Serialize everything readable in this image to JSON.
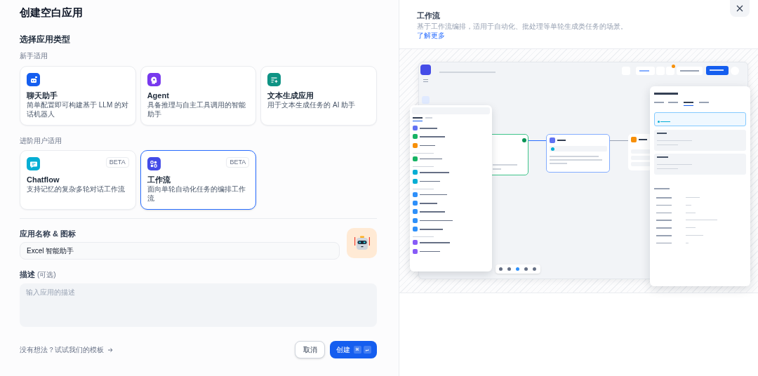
{
  "dialog": {
    "title": "创建空白应用"
  },
  "type_section": {
    "title": "选择应用类型",
    "groups": [
      {
        "label": "新手适用",
        "cards": [
          {
            "kind": "chat",
            "title": "聊天助手",
            "description": "简单配置即可构建基于 LLM 的对话机器人",
            "color": "#155eef",
            "selected": false
          },
          {
            "kind": "agent",
            "title": "Agent",
            "description": "具备推理与自主工具调用的智能助手",
            "color": "#7839ee",
            "selected": false
          },
          {
            "kind": "text",
            "title": "文本生成应用",
            "description": "用于文本生成任务的 AI 助手",
            "color": "#0e9384",
            "selected": false
          }
        ]
      },
      {
        "label": "进阶用户适用",
        "cards": [
          {
            "kind": "chatflow",
            "title": "Chatflow",
            "description": "支持记忆的复杂多轮对话工作流",
            "color": "#06aed4",
            "badge": "BETA",
            "selected": false
          },
          {
            "kind": "workflow",
            "title": "工作流",
            "description": "面向单轮自动化任务的编排工作流",
            "color": "#444ce7",
            "badge": "BETA",
            "selected": true
          }
        ]
      }
    ]
  },
  "name_field": {
    "label": "应用名称 & 图标",
    "value": "Excel 智能助手"
  },
  "description_field": {
    "label": "描述",
    "optional": "(可选)",
    "placeholder": "输入应用的描述"
  },
  "footer": {
    "template_link": "没有想法？试试我们的模板",
    "cancel": "取消",
    "create": "创建",
    "shortcut": [
      "⌘",
      "↵"
    ]
  },
  "preview": {
    "title": "工作流",
    "description": "基于工作流编排，适用于自动化、批处理等单轮生成类任务的场景。",
    "learn_more": "了解更多"
  }
}
